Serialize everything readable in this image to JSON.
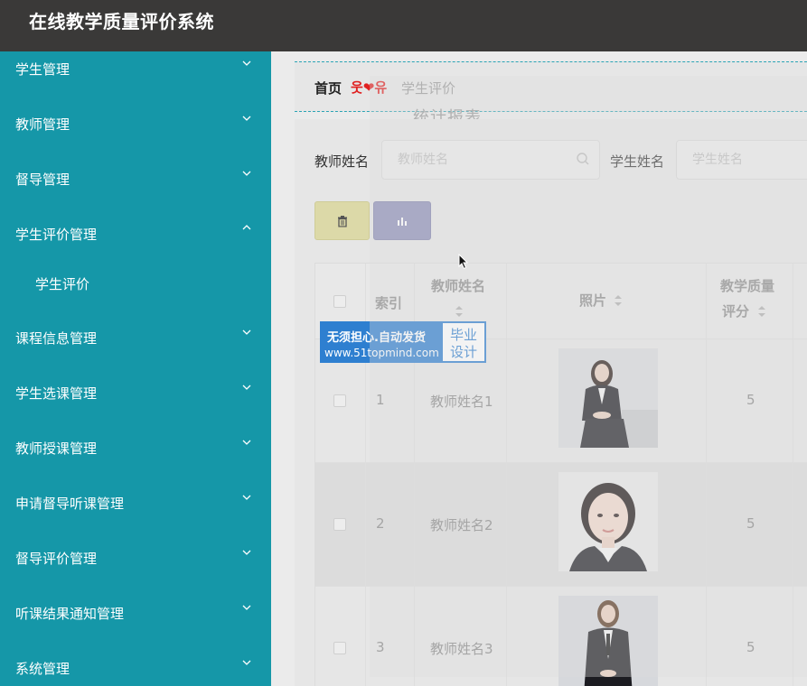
{
  "app": {
    "title": "在线教学质量评价系统"
  },
  "sidebar": {
    "items": [
      {
        "label": "学生管理",
        "expanded": false
      },
      {
        "label": "教师管理",
        "expanded": false
      },
      {
        "label": "督导管理",
        "expanded": false
      },
      {
        "label": "学生评价管理",
        "expanded": true
      },
      {
        "label": "课程信息管理",
        "expanded": false
      },
      {
        "label": "学生选课管理",
        "expanded": false
      },
      {
        "label": "教师授课管理",
        "expanded": false
      },
      {
        "label": "申请督导听课管理",
        "expanded": false
      },
      {
        "label": "督导评价管理",
        "expanded": false
      },
      {
        "label": "听课结果通知管理",
        "expanded": false
      },
      {
        "label": "系统管理",
        "expanded": false
      }
    ],
    "subitem": {
      "label": "学生评价"
    },
    "colors": {
      "background": "#1597a8"
    }
  },
  "breadcrumb": {
    "home": "首页",
    "separator": "웃❤유",
    "current": "学生评价",
    "ghost_title": "统计报表"
  },
  "search": {
    "teacher_label": "教师姓名",
    "teacher_placeholder": "教师姓名",
    "student_label": "学生姓名",
    "student_placeholder": "学生姓名"
  },
  "toolbar": {
    "delete_icon": "trash-icon",
    "stats_icon": "bar-chart-icon",
    "colors": {
      "delete": "#dcd9a8",
      "stats": "#8e8fb8"
    }
  },
  "table": {
    "headers": {
      "index": "索引",
      "teacher_name": "教师姓名",
      "photo": "照片",
      "score_line1": "教学质量",
      "score_line2": "评分"
    },
    "rows": [
      {
        "index": "1",
        "teacher_name": "教师姓名1",
        "photo": "woman-in-black-suit-seated",
        "score": "5"
      },
      {
        "index": "2",
        "teacher_name": "教师姓名2",
        "photo": "woman-portrait-headshot",
        "score": "5"
      },
      {
        "index": "3",
        "teacher_name": "教师姓名3",
        "photo": "woman-in-black-suit-standing",
        "score": "5"
      }
    ]
  },
  "watermark": {
    "line1": "无须担心.自动发货",
    "line2": "www.51topmind.com",
    "right1": "毕业",
    "right2": "设计"
  }
}
